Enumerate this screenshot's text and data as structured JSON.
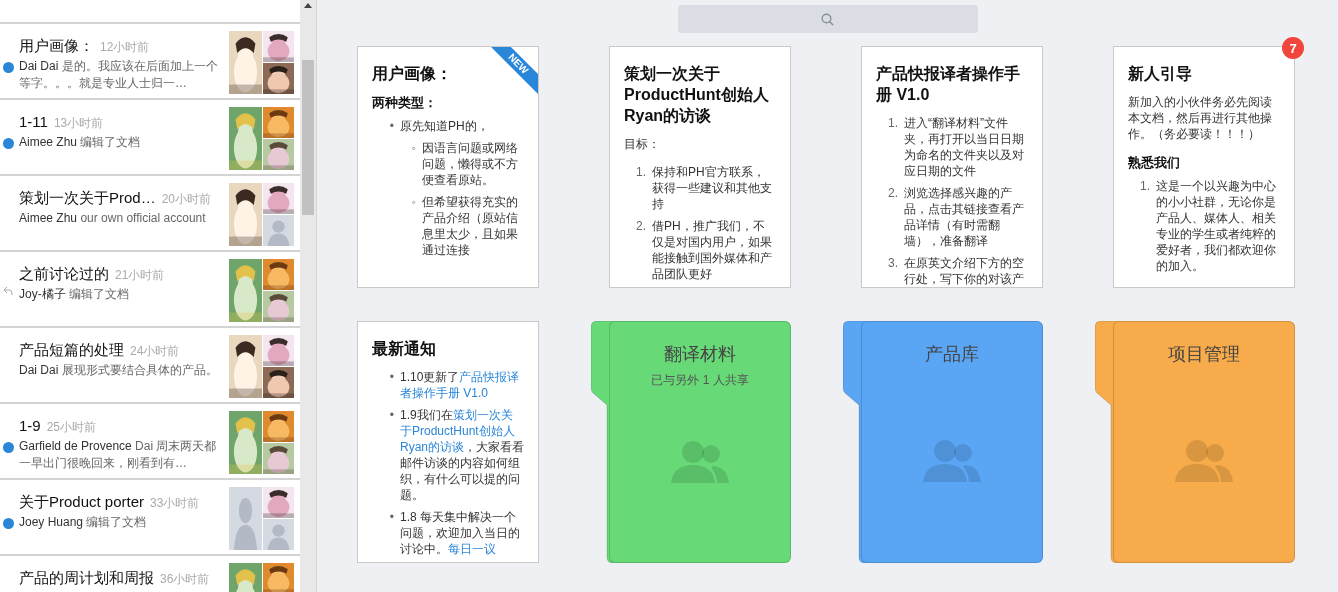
{
  "conversations": [
    {
      "title": "用户画像：",
      "time": "12小时前",
      "unread": true,
      "replied": false,
      "author": "Dai Dai",
      "message": "是的。我应该在后面加上一个等字。。。就是专业人士归一…",
      "avatars": [
        {
          "kind": "picture"
        },
        {
          "kind": "picture"
        },
        {
          "kind": "picture"
        }
      ]
    },
    {
      "title": "1-11",
      "time": "13小时前",
      "unread": true,
      "replied": false,
      "author": "Aimee Zhu",
      "message": "编辑了文档",
      "avatars": [
        {
          "kind": "picture"
        },
        {
          "kind": "picture"
        },
        {
          "kind": "picture"
        }
      ]
    },
    {
      "title": "策划一次关于Prod…",
      "time": "20小时前",
      "unread": false,
      "replied": false,
      "author": "Aimee Zhu",
      "message": "our own official account",
      "avatars": [
        {
          "kind": "picture"
        },
        {
          "kind": "picture"
        },
        {
          "kind": "placeholder"
        }
      ]
    },
    {
      "title": "之前讨论过的",
      "time": "21小时前",
      "unread": false,
      "replied": true,
      "author": "Joy-橘子",
      "message": "编辑了文档",
      "avatars": [
        {
          "kind": "picture"
        },
        {
          "kind": "picture"
        },
        {
          "kind": "picture"
        }
      ]
    },
    {
      "title": "产品短篇的处理",
      "time": "24小时前",
      "unread": false,
      "replied": false,
      "author": "Dai Dai",
      "message": "展现形式要结合具体的产品。",
      "avatars": [
        {
          "kind": "picture"
        },
        {
          "kind": "picture"
        },
        {
          "kind": "picture"
        }
      ]
    },
    {
      "title": "1-9",
      "time": "25小时前",
      "unread": true,
      "replied": false,
      "author": "Garfield de Provence",
      "message": "Dai 周末两天都一早出门很晚回来，刚看到有…",
      "avatars": [
        {
          "kind": "picture"
        },
        {
          "kind": "picture"
        },
        {
          "kind": "picture"
        }
      ]
    },
    {
      "title": "关于Product porter",
      "time": "33小时前",
      "unread": true,
      "replied": false,
      "author": "Joey Huang",
      "message": "编辑了文档",
      "avatars": [
        {
          "kind": "placeholder"
        },
        {
          "kind": "picture"
        },
        {
          "kind": "placeholder"
        }
      ]
    },
    {
      "title": "产品的周计划和周报",
      "time": "36小时前",
      "avatars": [
        {
          "kind": "picture"
        },
        {
          "kind": "picture"
        }
      ]
    }
  ],
  "documents": [
    {
      "title": "用户画像：",
      "new_ribbon": "NEW",
      "blocks": [
        {
          "kind": "heading",
          "text": "两种类型："
        },
        {
          "kind": "ul",
          "items": [
            {
              "marker": "•",
              "text": "原先知道PH的，",
              "children": [
                {
                  "marker": "◦",
                  "text": "因语言问题或网络问题，懒得或不方便查看原站。"
                },
                {
                  "marker": "◦",
                  "text": "但希望获得充实的产品介绍（原站信息里太少，且如果通过连接"
                }
              ]
            }
          ]
        }
      ]
    },
    {
      "title": "策划一次关于ProductHunt创始人Ryan的访谈",
      "blocks": [
        {
          "kind": "para",
          "text": "目标："
        },
        {
          "kind": "ol",
          "items": [
            {
              "marker": "1.",
              "text": "保持和PH官方联系，获得一些建议和其他支持"
            },
            {
              "marker": "2.",
              "text": "借PH，推广我们，不仅是对国内用户，如果能接触到国外媒体和产品团队更好"
            }
          ]
        }
      ]
    },
    {
      "title": "产品快报译者操作手册 V1.0",
      "blocks": [
        {
          "kind": "ol",
          "items": [
            {
              "marker": "1.",
              "text": "进入“翻译材料”文件夹，再打开以当日日期为命名的文件夹以及对应日期的文件"
            },
            {
              "marker": "2.",
              "text": "浏览选择感兴趣的产品，点击其链接查看产品详情（有时需翻墙），准备翻译"
            },
            {
              "marker": "3.",
              "text": "在原英文介绍下方的空行处，写下你的对该产"
            }
          ]
        }
      ]
    },
    {
      "title": "新人引导",
      "badge": "7",
      "blocks": [
        {
          "kind": "para",
          "text": "新加入的小伙伴务必先阅读本文档，然后再进行其他操作。（务必要读！！！）"
        },
        {
          "kind": "heading",
          "text": "熟悉我们"
        },
        {
          "kind": "ol",
          "items": [
            {
              "marker": "1.",
              "text": "这是一个以兴趣为中心的小小社群，无论你是产品人、媒体人、相关专业的学生或者纯粹的爱好者，我们都欢迎你的加入。"
            }
          ]
        }
      ]
    },
    {
      "title": "最新通知",
      "blocks": [
        {
          "kind": "ul",
          "items": [
            {
              "marker": "•",
              "segments": [
                {
                  "kind": "text",
                  "text": "1.10更新了"
                },
                {
                  "kind": "link",
                  "text": "产品快报译"
                },
                {
                  "kind": "link",
                  "text": "者操作手册 V1.0"
                }
              ]
            },
            {
              "marker": "•",
              "segments": [
                {
                  "kind": "text",
                  "text": "1.9我们在"
                },
                {
                  "kind": "link",
                  "text": "策划一次关"
                },
                {
                  "kind": "link",
                  "text": "于ProductHunt创始人"
                },
                {
                  "kind": "link",
                  "text": "Ryan的访谈"
                },
                {
                  "kind": "text",
                  "text": "，大家看看邮件访谈的内容如何组织，有什么可以提的问题。"
                }
              ]
            },
            {
              "marker": "•",
              "segments": [
                {
                  "kind": "text",
                  "text": "1.8 每天集中解决一个问题，欢迎加入当日的讨论中。"
                },
                {
                  "kind": "link",
                  "text": "每日一议"
                }
              ]
            }
          ]
        }
      ]
    }
  ],
  "folders": [
    {
      "name": "翻译材料",
      "shared": "已与另外 1 人共享",
      "color": "#67d977"
    },
    {
      "name": "产品库",
      "color": "#5aa6f5"
    },
    {
      "name": "项目管理",
      "color": "#f7ab4b"
    }
  ]
}
